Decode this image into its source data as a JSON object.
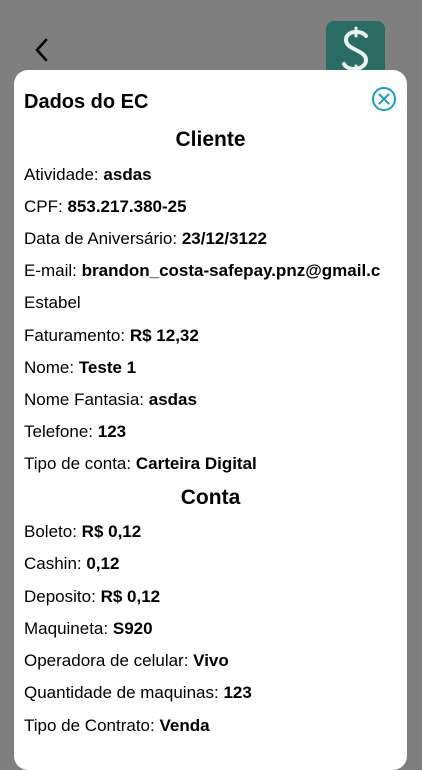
{
  "modal": {
    "title": "Dados do EC",
    "cliente_header": "Cliente",
    "conta_header": "Conta"
  },
  "cliente": {
    "atividade": {
      "label": "Atividade:",
      "value": "asdas"
    },
    "cpf": {
      "label": "CPF:",
      "value": "853.217.380-25"
    },
    "aniversario": {
      "label": "Data de Aniversário:",
      "value": "23/12/3122"
    },
    "email": {
      "label": "E-mail:",
      "value": "brandon_costa-safepay.pnz@gmail.c"
    },
    "estabelecimento": {
      "label": "Estabel"
    },
    "faturamento": {
      "label": "Faturamento:",
      "value": "R$ 12,32"
    },
    "nome": {
      "label": "Nome:",
      "value": "Teste 1"
    },
    "nome_fantasia": {
      "label": "Nome Fantasia:",
      "value": "asdas"
    },
    "telefone": {
      "label": "Telefone:",
      "value": "123"
    },
    "tipo_conta": {
      "label": "Tipo de conta:",
      "value": "Carteira Digital"
    }
  },
  "conta": {
    "boleto": {
      "label": "Boleto:",
      "value": "R$ 0,12"
    },
    "cashin": {
      "label": "Cashin:",
      "value": "0,12"
    },
    "deposito": {
      "label": "Deposito:",
      "value": "R$ 0,12"
    },
    "maquineta": {
      "label": "Maquineta:",
      "value": "S920"
    },
    "operadora": {
      "label": "Operadora de celular:",
      "value": "Vivo"
    },
    "quantidade": {
      "label": "Quantidade de maquinas:",
      "value": "123"
    },
    "contrato": {
      "label": "Tipo de Contrato:",
      "value": "Venda"
    }
  },
  "icons": {
    "back": "chevron-left-icon",
    "close": "close-circle-icon",
    "logo": "app-logo-icon"
  },
  "colors": {
    "accent": "#1a9fb8",
    "logo_bg": "#2a6b63",
    "overlay": "#7f7f7f"
  }
}
